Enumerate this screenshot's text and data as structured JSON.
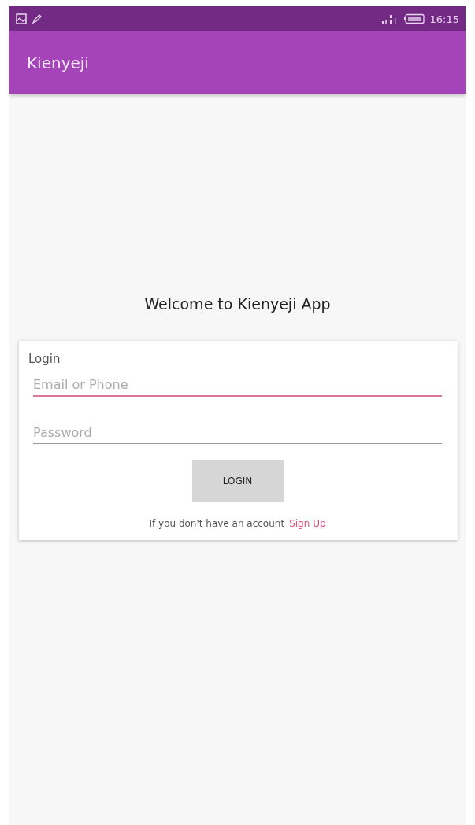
{
  "status_bar": {
    "time": "16:15"
  },
  "app_bar": {
    "title": "Kienyeji"
  },
  "welcome": "Welcome to Kienyeji App",
  "login_card": {
    "title": "Login",
    "fields": [
      {
        "placeholder": "Email or Phone",
        "focused": true
      },
      {
        "placeholder": "Password",
        "focused": false
      }
    ],
    "button": "LOGIN",
    "prompt": "If you don't have an account",
    "link": "Sign Up"
  }
}
